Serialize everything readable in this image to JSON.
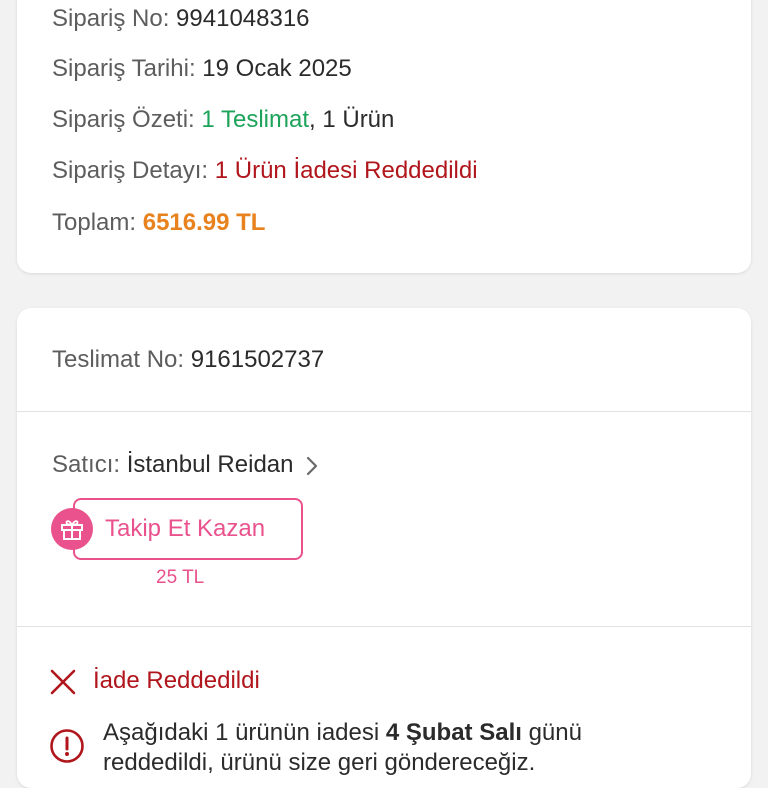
{
  "order": {
    "number_label": "Sipariş No:",
    "number_value": "9941048316",
    "date_label": "Sipariş Tarihi:",
    "date_value": "19 Ocak 2025",
    "summary_label": "Sipariş Özeti:",
    "summary_delivery": "1 Teslimat",
    "summary_sep": ",",
    "summary_items": "1 Ürün",
    "detail_label": "Sipariş Detayı:",
    "detail_value": "1 Ürün İadesi Reddedildi",
    "total_label": "Toplam:",
    "total_value": "6516.99 TL"
  },
  "delivery": {
    "number_label": "Teslimat No:",
    "number_value": "9161502737",
    "seller_label": "Satıcı:",
    "seller_name": "İstanbul Reidan",
    "follow_button": "Takip Et Kazan",
    "follow_reward": "25 TL",
    "status": "İade Reddedildi",
    "info_text_1": "Aşağıdaki 1 ürünün iadesi ",
    "info_date": "4 Şubat Salı",
    "info_text_2": " günü reddedildi, ürünü size geri göndereceğiz."
  },
  "colors": {
    "green": "#1da35a",
    "red": "#b0161c",
    "orange": "#e8821f",
    "pink": "#e9528c"
  },
  "icons": [
    "gift-icon",
    "chevron-right-icon",
    "close-icon",
    "info-icon"
  ]
}
